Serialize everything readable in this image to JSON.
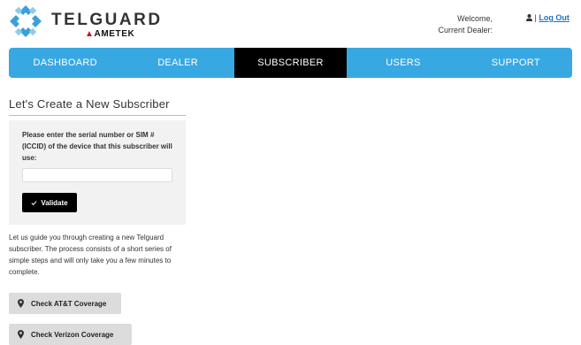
{
  "header": {
    "brand": "TELGUARD",
    "brand_sub": "AMETEK",
    "welcome_line1": "Welcome,",
    "welcome_line2": "Current Dealer:",
    "separator": "|",
    "logout_label": "Log Out"
  },
  "nav": {
    "items": [
      {
        "label": "DASHBOARD"
      },
      {
        "label": "DEALER"
      },
      {
        "label": "SUBSCRIBER"
      },
      {
        "label": "USERS"
      },
      {
        "label": "SUPPORT"
      }
    ],
    "active": "SUBSCRIBER"
  },
  "main": {
    "title": "Let's Create a New Subscriber",
    "panel": {
      "label": "Please enter the serial number or SIM # (ICCID) of the device that this subscriber will use:",
      "input_value": "",
      "input_placeholder": "",
      "validate_label": "Validate"
    },
    "guide_text": "Let us guide you through creating a new Telguard subscriber. The process consists of a short series of simple steps and will only take you a few minutes to complete.",
    "coverage_buttons": [
      {
        "label": "Check AT&T Coverage"
      },
      {
        "label": "Check Verizon Coverage"
      }
    ]
  },
  "colors": {
    "nav_bg": "#37a8e2",
    "nav_active": "#000000",
    "logo_blue": "#3aa0dc",
    "logout_link": "#1a73c9",
    "brand_accent": "#c8102e"
  },
  "icons": [
    "telguard-logo",
    "user-icon",
    "check-icon",
    "map-pin-icon"
  ]
}
